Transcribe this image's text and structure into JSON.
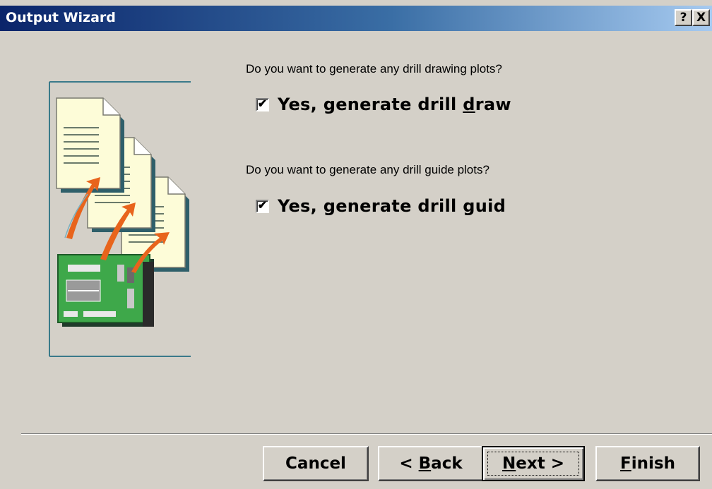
{
  "window": {
    "title": "Output Wizard",
    "help_button": "?",
    "close_button": "X"
  },
  "drill_drawing": {
    "question": "Do you want to generate any drill drawing plots?",
    "checkbox_label_pre": "Yes, generate drill ",
    "checkbox_label_mnemonic": "d",
    "checkbox_label_post": "raw",
    "checked": true
  },
  "drill_guide": {
    "question": "Do you want to generate any drill guide plots?",
    "checkbox_label": "Yes, generate drill guid",
    "checked": true
  },
  "buttons": {
    "cancel": "Cancel",
    "back_pre": "< ",
    "back_mnemonic": "B",
    "back_post": "ack",
    "next_mnemonic": "N",
    "next_post": "ext >",
    "finish_mnemonic": "F",
    "finish_post": "inish"
  },
  "check_glyph": "✔",
  "colors": {
    "titlebar_start": "#0a246a",
    "titlebar_end": "#a6caf0",
    "dialog_bg": "#d4d0c8",
    "illustration_frame": "#3a7a8a"
  }
}
